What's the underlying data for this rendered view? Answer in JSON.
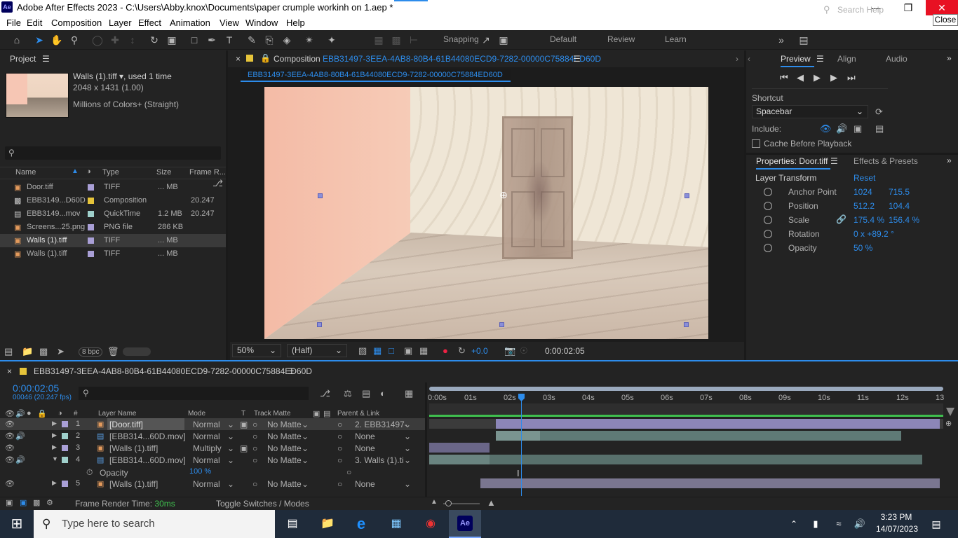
{
  "window": {
    "title": "Adobe After Effects 2023 - C:\\Users\\Abby.knox\\Documents\\paper crumple workinh on 1.aep *",
    "app_badge": "Ae",
    "close_tooltip": "Close"
  },
  "menu": [
    "File",
    "Edit",
    "Composition",
    "Layer",
    "Effect",
    "Animation",
    "View",
    "Window",
    "Help"
  ],
  "toolbar": {
    "snapping": "Snapping",
    "workspaces": [
      "Default",
      "Review",
      "Learn"
    ],
    "search_placeholder": "Search Help"
  },
  "project": {
    "tab": "Project",
    "selected_name": "Walls (1).tiff",
    "used": ", used 1 time",
    "dims": "2048 x 1431 (1.00)",
    "colors": "Millions of Colors+ (Straight)",
    "columns": [
      "Name",
      "Type",
      "Size",
      "Frame R..."
    ],
    "items": [
      {
        "name": "Door.tiff",
        "color": "#a99fd6",
        "type": "TIFF",
        "size": "... MB",
        "rate": ""
      },
      {
        "name": "EBB3149...D60D",
        "color": "#e6c43a",
        "type": "Composition",
        "size": "",
        "rate": "20.247"
      },
      {
        "name": "EBB3149...mov",
        "color": "#9fd0cb",
        "type": "QuickTime",
        "size": "1.2 MB",
        "rate": "20.247"
      },
      {
        "name": "Screens...25.png",
        "color": "#a99fd6",
        "type": "PNG file",
        "size": "286 KB",
        "rate": ""
      },
      {
        "name": "Walls (1).tiff",
        "color": "#a99fd6",
        "type": "TIFF",
        "size": "... MB",
        "rate": ""
      },
      {
        "name": "Walls (1).tiff",
        "color": "#a99fd6",
        "type": "TIFF",
        "size": "... MB",
        "rate": ""
      }
    ],
    "bpc": "8 bpc"
  },
  "composition": {
    "label": "Composition",
    "name": "EBB31497-3EEA-4AB8-80B4-61B44080ECD9-7282-00000C75884ED60D",
    "zoom": "50%",
    "resolution": "(Half)",
    "exposure": "+0.0",
    "timecode": "0:00:02:05"
  },
  "preview": {
    "tabs": [
      "Preview",
      "Align",
      "Audio"
    ],
    "shortcut_label": "Shortcut",
    "shortcut_value": "Spacebar",
    "include_label": "Include:",
    "cache_label": "Cache Before Playback"
  },
  "properties": {
    "tab": "Properties: Door.tiff",
    "tab2": "Effects & Presets",
    "section": "Layer Transform",
    "reset": "Reset",
    "rows": [
      {
        "label": "Anchor Point",
        "v1": "1024",
        "v2": "715.5"
      },
      {
        "label": "Position",
        "v1": "512.2",
        "v2": "104.4"
      },
      {
        "label": "Scale",
        "v1": "175.4 %",
        "v2": "156.4 %"
      },
      {
        "label": "Rotation",
        "v1": "0 x +89.2 °",
        "v2": ""
      },
      {
        "label": "Opacity",
        "v1": "50 %",
        "v2": ""
      }
    ]
  },
  "timeline": {
    "comp_name": "EBB31497-3EEA-4AB8-80B4-61B44080ECD9-7282-00000C75884ED60D",
    "timecode": "0:00:02:05",
    "fps": "00046 (20.247 fps)",
    "columns": [
      "#",
      "Layer Name",
      "Mode",
      "T",
      "Track Matte",
      "Parent & Link"
    ],
    "ruler": [
      "0:00s",
      "01s",
      "02s",
      "03s",
      "04s",
      "05s",
      "06s",
      "07s",
      "08s",
      "09s",
      "10s",
      "11s",
      "12s",
      "13"
    ],
    "layers": [
      {
        "num": "1",
        "name": "[Door.tiff]",
        "color": "#a99fd6",
        "mode": "Normal",
        "matte": "No Matte",
        "parent": "2. EBB31497-",
        "selected": true
      },
      {
        "num": "2",
        "name": "[EBB314...60D.mov]",
        "color": "#9fd0cb",
        "mode": "Normal",
        "matte": "No Matte",
        "parent": "None"
      },
      {
        "num": "3",
        "name": "[Walls (1).tiff]",
        "color": "#a99fd6",
        "mode": "Multiply",
        "matte": "No Matte",
        "parent": "None"
      },
      {
        "num": "4",
        "name": "[EBB314...60D.mov]",
        "color": "#9fd0cb",
        "mode": "Normal",
        "matte": "No Matte",
        "parent": "3. Walls (1).ti"
      },
      {
        "num": "5",
        "name": "[Walls (1).tiff]",
        "color": "#a99fd6",
        "mode": "Normal",
        "matte": "No Matte",
        "parent": "None"
      }
    ],
    "opacity_label": "Opacity",
    "opacity_value": "100 %",
    "render_label": "Frame Render Time:",
    "render_value": "30ms",
    "toggle_label": "Toggle Switches / Modes"
  },
  "taskbar": {
    "search_placeholder": "Type here to search",
    "time": "3:23 PM",
    "date": "14/07/2023"
  }
}
